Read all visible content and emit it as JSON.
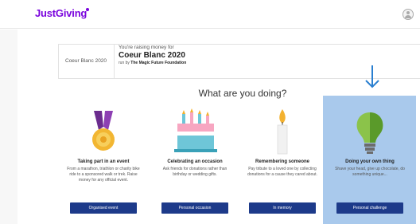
{
  "header": {
    "logo": "JustGiving",
    "logo_mark": "™"
  },
  "cause": {
    "left_label": "Coeur Blanc 2020",
    "raising_text": "You're raising money for",
    "name": "Coeur Blanc 2020",
    "run_by_prefix": "run by",
    "run_by_org": "The Magic Future Foundation"
  },
  "question": "What are you doing?",
  "options": [
    {
      "title": "Taking part in an event",
      "description": "From a marathon, triathlon or charity bike ride to a sponsored walk or trek. Raise money for any official event.",
      "button": "Organised event",
      "icon": "medal-icon"
    },
    {
      "title": "Celebrating an occasion",
      "description": "Ask friends for donations rather than birthday or wedding gifts.",
      "button": "Personal occasion",
      "icon": "cake-icon"
    },
    {
      "title": "Remembering someone",
      "description": "Pay tribute to a loved one by collecting donations for a cause they cared about.",
      "button": "In memory",
      "icon": "candle-icon"
    },
    {
      "title": "Doing your own thing",
      "description": "Shave your head, give up chocolate, do something unique...",
      "button": "Personal challenge",
      "icon": "lightbulb-icon"
    }
  ],
  "colors": {
    "brand": "#7a04dd",
    "button": "#1d3a8a",
    "highlight": "#a9c9ec",
    "arrow": "#2a7fd0"
  }
}
